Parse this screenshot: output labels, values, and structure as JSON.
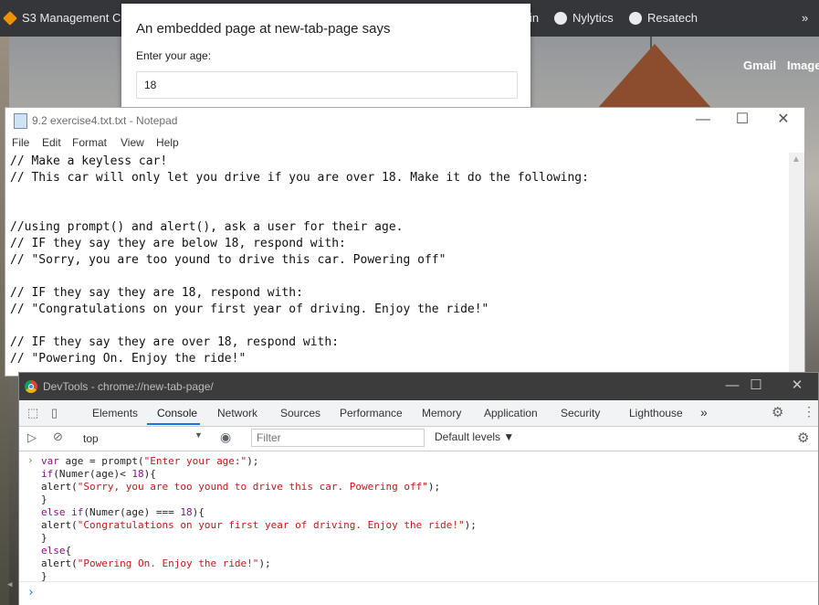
{
  "bookmarks": [
    {
      "label": "S3 Management Co...",
      "icon": "aws-icon"
    },
    {
      "label": "in",
      "icon": ""
    },
    {
      "label": "Nylytics",
      "icon": "globe-icon"
    },
    {
      "label": "Resatech",
      "icon": "globe-icon"
    }
  ],
  "bookmarks_overflow": "»",
  "google_links": {
    "gmail": "Gmail",
    "images": "Image"
  },
  "prompt": {
    "title": "An embedded page at new-tab-page says",
    "label": "Enter your age:",
    "value": "18"
  },
  "notepad": {
    "title": "9.2 exercise4.txt.txt - Notepad",
    "menu": [
      "File",
      "Edit",
      "Format",
      "View",
      "Help"
    ],
    "minimize": "—",
    "maximize": "☐",
    "close": "✕",
    "lines": [
      "// Make a keyless car!",
      "// This car will only let you drive if you are over 18. Make it do the following:",
      "",
      "",
      "//using prompt() and alert(), ask a user for their age.",
      "// IF they say they are below 18, respond with:",
      "// \"Sorry, you are too yound to drive this car. Powering off\"",
      "",
      "// IF they say they are 18, respond with:",
      "// \"Congratulations on your first year of driving. Enjoy the ride!\"",
      "",
      "// IF they say they are over 18, respond with:",
      "// \"Powering On. Enjoy the ride!\""
    ]
  },
  "devtools": {
    "title": "DevTools - chrome://new-tab-page/",
    "minimize": "—",
    "maximize": "☐",
    "close": "✕",
    "tabs": [
      "Elements",
      "Console",
      "Network",
      "Sources",
      "Performance",
      "Memory",
      "Application",
      "Security",
      "Lighthouse"
    ],
    "active_tab": "Console",
    "more_tabs": "»",
    "context": "top",
    "context_arrow": "▼",
    "filter_placeholder": "Filter",
    "levels": "Default levels ▼",
    "console_prompt": "›",
    "code": [
      [
        {
          "t": "kw",
          "v": "var"
        },
        {
          "t": "txt",
          "v": " age = prompt("
        },
        {
          "t": "str",
          "v": "\"Enter your age:\""
        },
        {
          "t": "txt",
          "v": ");"
        }
      ],
      [
        {
          "t": "kw",
          "v": "if"
        },
        {
          "t": "txt",
          "v": "(Numer(age)< "
        },
        {
          "t": "kw",
          "v": "18"
        },
        {
          "t": "txt",
          "v": "){"
        }
      ],
      [
        {
          "t": "txt",
          "v": "alert("
        },
        {
          "t": "str",
          "v": "\"Sorry, you are too yound to drive this car. Powering off\""
        },
        {
          "t": "txt",
          "v": ");"
        }
      ],
      [
        {
          "t": "txt",
          "v": "}"
        }
      ],
      [
        {
          "t": "kw",
          "v": "else if"
        },
        {
          "t": "txt",
          "v": "(Numer(age) === "
        },
        {
          "t": "kw",
          "v": "18"
        },
        {
          "t": "txt",
          "v": "){"
        }
      ],
      [
        {
          "t": "txt",
          "v": "alert("
        },
        {
          "t": "str",
          "v": "\"Congratulations on your first year of driving. Enjoy the ride!\""
        },
        {
          "t": "txt",
          "v": ");"
        }
      ],
      [
        {
          "t": "txt",
          "v": "}"
        }
      ],
      [
        {
          "t": "kw",
          "v": "else"
        },
        {
          "t": "txt",
          "v": "{"
        }
      ],
      [
        {
          "t": "txt",
          "v": "alert("
        },
        {
          "t": "str",
          "v": "\"Powering On. Enjoy the ride!\""
        },
        {
          "t": "txt",
          "v": ");"
        }
      ],
      [
        {
          "t": "txt",
          "v": "}"
        }
      ]
    ]
  },
  "colors": {
    "accent": "#1a73e8",
    "keyword": "#881280",
    "string": "#c41a16"
  }
}
